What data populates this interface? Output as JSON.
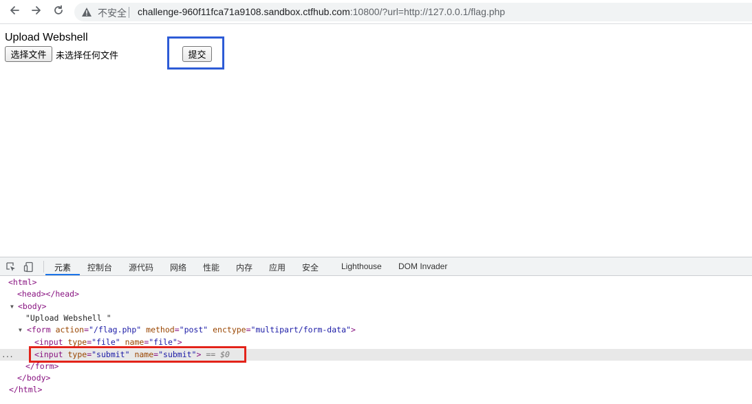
{
  "browser": {
    "security_label": "不安全",
    "url_host": "challenge-960f11fca71a9108.sandbox.ctfhub.com",
    "url_rest": ":10800/?url=http://127.0.0.1/flag.php",
    "icons": [
      "back-arrow-icon",
      "forward-arrow-icon",
      "reload-icon",
      "warning-icon"
    ]
  },
  "page": {
    "title": "Upload Webshell",
    "choose_file_label": "选择文件",
    "no_file_label": "未选择任何文件",
    "submit_label": "提交"
  },
  "highlight_colors": {
    "blue": "#2d5bd6",
    "red": "#e3231a"
  },
  "devtools": {
    "tabs": [
      {
        "label": "元素",
        "active": true
      },
      {
        "label": "控制台"
      },
      {
        "label": "源代码"
      },
      {
        "label": "网络"
      },
      {
        "label": "性能"
      },
      {
        "label": "内存"
      },
      {
        "label": "应用"
      },
      {
        "label": "安全"
      },
      {
        "label": "Lighthouse"
      },
      {
        "label": "DOM Invader"
      }
    ],
    "dom": {
      "html_open": "<html>",
      "head": "<head></head>",
      "body_open": "<body>",
      "text_node": "\"Upload Webshell \"",
      "form_tag_open": "<form",
      "form_action_name": "action",
      "form_action_value": "\"/flag.php\"",
      "form_method_name": "method",
      "form_method_value": "\"post\"",
      "form_enctype_name": "enctype",
      "form_enctype_value": "\"multipart/form-data\"",
      "form_tag_close": ">",
      "input1_tag_open": "<input",
      "input1_type_name": "type",
      "input1_type_value": "\"file\"",
      "input1_name_name": "name",
      "input1_name_value": "\"file\"",
      "input1_tag_close": ">",
      "input2_tag_open": "<input",
      "input2_type_name": "type",
      "input2_type_value": "\"submit\"",
      "input2_name_name": "name",
      "input2_name_value": "\"submit\"",
      "input2_tag_close": ">",
      "selected_marker": "== $0",
      "form_close": "</form>",
      "body_close": "</body>",
      "html_close": "</html>",
      "row_menu": "..."
    }
  }
}
